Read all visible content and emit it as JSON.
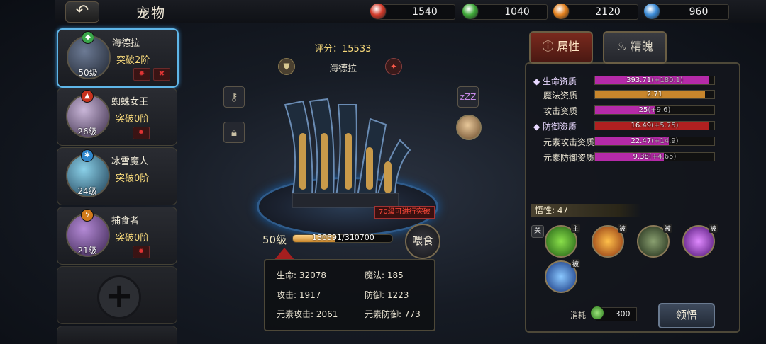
{
  "header": {
    "title": "宠物",
    "back_label": "↶"
  },
  "resources": [
    {
      "icon": "red-gem-icon",
      "color": "#d23a2a",
      "value": "1540"
    },
    {
      "icon": "green-gem-icon",
      "color": "#3ea838",
      "value": "1040"
    },
    {
      "icon": "lightning-orb-icon",
      "color": "#e2801e",
      "value": "2120"
    },
    {
      "icon": "snowflake-orb-icon",
      "color": "#3a8ad6",
      "value": "960"
    }
  ],
  "pets": [
    {
      "name": "海德拉",
      "breakthrough": "突破2阶",
      "level": "50级",
      "element": "wind",
      "element_color": "#3aa84a",
      "element_glyph": "◆",
      "active": true
    },
    {
      "name": "蜘蛛女王",
      "breakthrough": "突破0阶",
      "level": "26级",
      "element": "fire",
      "element_color": "#c8321e",
      "element_glyph": "▲",
      "active": false
    },
    {
      "name": "冰雪魔人",
      "breakthrough": "突破0阶",
      "level": "24级",
      "element": "ice",
      "element_color": "#2f86cc",
      "element_glyph": "✱",
      "active": false
    },
    {
      "name": "捕食者",
      "breakthrough": "突破0阶",
      "level": "21级",
      "element": "lightning",
      "element_color": "#d27a1a",
      "element_glyph": "ϟ",
      "active": false
    }
  ],
  "center": {
    "score_label": "评分：15533",
    "pet_name": "海德拉",
    "level": "50级",
    "exp_text": "130591/310700",
    "exp_fraction": 0.42,
    "breakthrough_note": "70级可进行突破",
    "feed_label": "喂食",
    "sleep_label": "zZZ",
    "stats": [
      {
        "label": "生命: 32078"
      },
      {
        "label": "魔法: 185"
      },
      {
        "label": "攻击: 1917"
      },
      {
        "label": "防御: 1223"
      },
      {
        "label": "元素攻击: 2061"
      },
      {
        "label": "元素防御: 773"
      }
    ]
  },
  "panel": {
    "tabs": [
      {
        "label": "属性",
        "active": true
      },
      {
        "label": "精魄",
        "active": false
      }
    ],
    "aptitudes": [
      {
        "label": "◆ 生命资质",
        "base": "393.71",
        "bonus": "(+180.1)",
        "fill": 0.95,
        "color": "#b52aa8",
        "highlight": true
      },
      {
        "label": "魔法资质",
        "base": "2.71",
        "bonus": "",
        "fill": 0.92,
        "color": "#c8862c",
        "highlight": false
      },
      {
        "label": "攻击资质",
        "base": "25",
        "bonus": "(+9.6)",
        "fill": 0.5,
        "color": "#b52aa8",
        "highlight": false
      },
      {
        "label": "◆ 防御资质",
        "base": "16.49",
        "bonus": "(+5.75)",
        "fill": 0.96,
        "color": "#b02020",
        "highlight": true
      },
      {
        "label": "元素攻击资质",
        "base": "22.47",
        "bonus": "(+14.9)",
        "fill": 0.62,
        "color": "#b52aa8",
        "highlight": false
      },
      {
        "label": "元素防御资质",
        "base": "9.38",
        "bonus": "(+4.65)",
        "fill": 0.58,
        "color": "#b52aa8",
        "highlight": false
      }
    ],
    "wisdom": "悟性: 47",
    "lock_toggle": "关",
    "skills": [
      {
        "icon": "green-slash-skill-icon",
        "tag": "主",
        "color": "#3a9a2a"
      },
      {
        "icon": "orange-burst-skill-icon",
        "tag": "被",
        "color": "#d2701a"
      },
      {
        "icon": "dragon-skull-skill-icon",
        "tag": "被",
        "color": "#4a6a3a"
      },
      {
        "icon": "purple-triangle-skill-icon",
        "tag": "被",
        "color": "#8a2ad2"
      },
      {
        "icon": "blue-arrow-skill-icon",
        "tag": "被",
        "color": "#2a62c8"
      }
    ],
    "consume_label": "消耗",
    "consume_value": "300",
    "comprehend_label": "领悟"
  }
}
